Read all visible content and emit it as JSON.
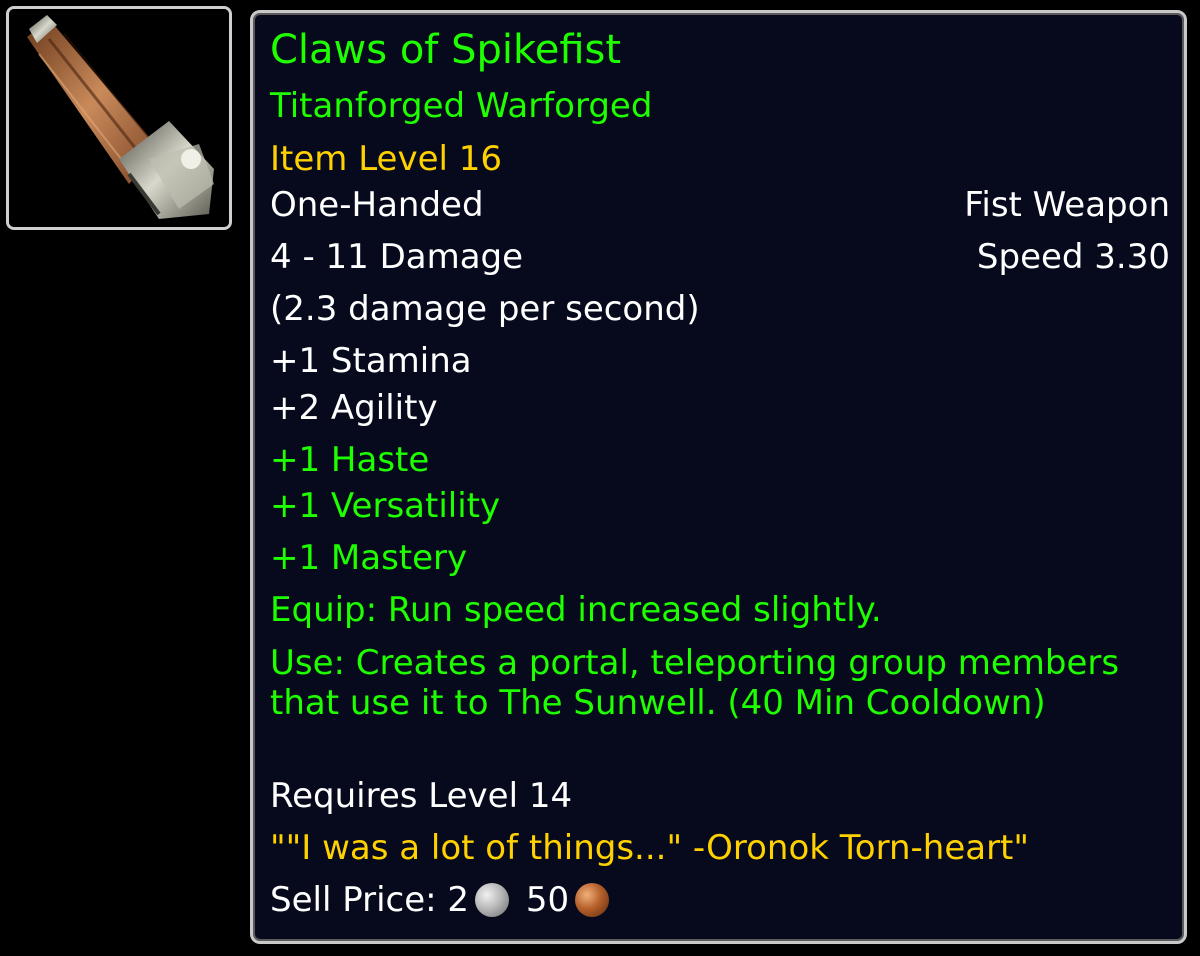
{
  "item": {
    "name": "Claws of Spikefist",
    "tier": "Titanforged Warforged",
    "item_level": "Item Level 16",
    "slot": "One-Handed",
    "weapon_type": "Fist Weapon",
    "damage": "4 - 11 Damage",
    "speed": "Speed 3.30",
    "dps": "(2.3 damage per second)",
    "stats": [
      "+1 Stamina",
      "+2 Agility"
    ],
    "secondary_stats": [
      "+1 Haste",
      "+1 Versatility",
      "+1 Mastery"
    ],
    "equip": "Equip: Run speed increased slightly.",
    "use": "Use: Creates a portal, teleporting group members that use it to The Sunwell. (40 Min Cooldown)",
    "requires": "Requires Level 14",
    "flavor": "\"\"I was a lot of things...\" -Oronok Torn-heart\"",
    "sell_label": "Sell Price:",
    "sell_silver": "2",
    "sell_copper": "50"
  },
  "colors": {
    "name": "#1eff00",
    "yellow": "#ffd100",
    "white": "#ffffff",
    "background": "#060a1c"
  },
  "icons": {
    "item_icon": "fist-weapon-icon",
    "silver": "silver-coin-icon",
    "copper": "copper-coin-icon"
  }
}
